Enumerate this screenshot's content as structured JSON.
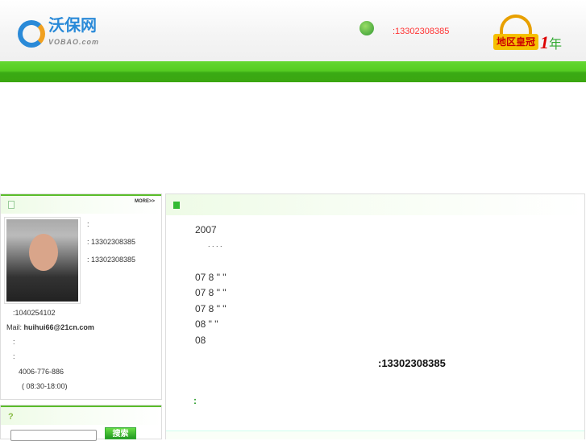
{
  "header": {
    "logo_text": "沃保网",
    "logo_sub": "VOBAO.com",
    "phone": ":13302308385",
    "badge": "地区皇冠",
    "years_num": "1",
    "years_unit": "年"
  },
  "left_panel": {
    "more": "MORE>>",
    "colon": ":",
    "mobile": ": 13302308385",
    "phone": ": 13302308385",
    "qq": ":1040254102",
    "mail_label": "Mail:",
    "mail": "huihui66@21cn.com",
    "c1": ":",
    "c2": ":",
    "hotline": "4006-776-886",
    "hours": "(      08:30-18:00)"
  },
  "search": {
    "button": "搜索",
    "value": ""
  },
  "main": {
    "year": "2007",
    "dots": ".       .       .       .",
    "lines": [
      "07 8   \"    \"",
      "07 8   \"    \"",
      "07 8   \"    \"",
      "08        \"    \"",
      "08"
    ],
    "contact": ":13302308385",
    "colon": ":"
  }
}
